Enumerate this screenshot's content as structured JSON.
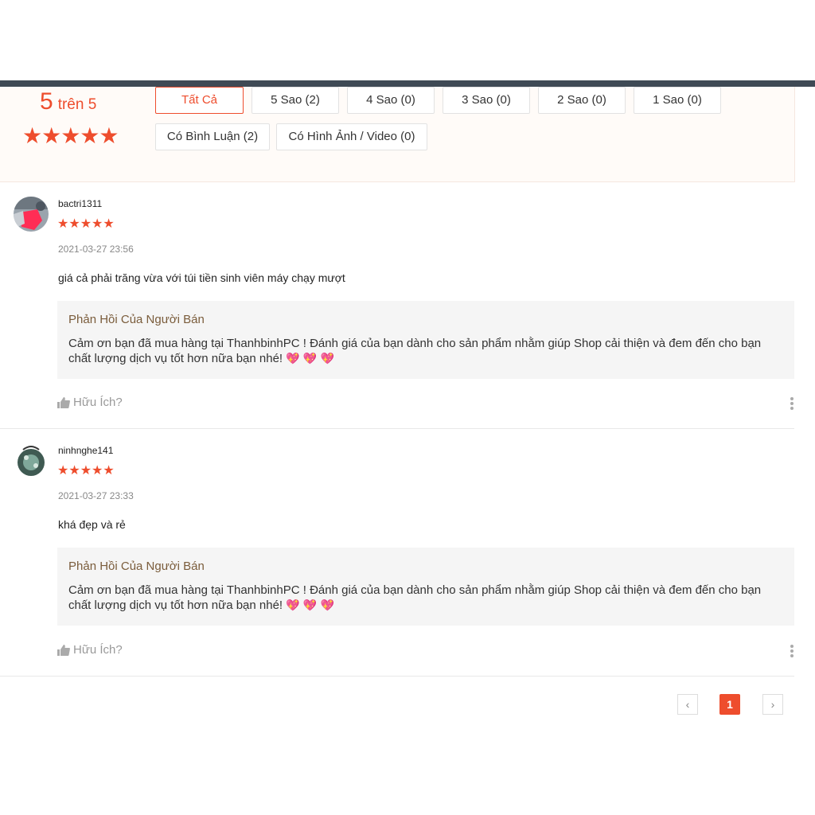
{
  "summary": {
    "score": "5",
    "score_suffix": "trên 5",
    "stars": "★★★★★"
  },
  "filters": [
    {
      "label": "Tất Cả"
    },
    {
      "label": "5 Sao (2)"
    },
    {
      "label": "4 Sao (0)"
    },
    {
      "label": "3 Sao (0)"
    },
    {
      "label": "2 Sao (0)"
    },
    {
      "label": "1 Sao (0)"
    },
    {
      "label": "Có Bình Luận (2)"
    },
    {
      "label": "Có Hình Ảnh / Video (0)"
    }
  ],
  "reviews": [
    {
      "username": "bactri1311",
      "stars": "★★★★★",
      "rating": 5,
      "time": "2021-03-27 23:56",
      "comment": "giá cả phải trăng vừa với túi tiền sinh viên máy chạy mượt",
      "reply_title": "Phản Hồi Của Người Bán",
      "reply_text": "Cảm ơn bạn đã mua hàng tại ThanhbinhPC ! Đánh giá của bạn dành cho sản phẩm nhằm giúp Shop cải thiện và đem đến cho bạn chất lượng dịch vụ tốt hơn nữa bạn nhé!",
      "helpful": "Hữu Ích?"
    },
    {
      "username": "ninhnghe141",
      "stars": "★★★★★",
      "rating": 5,
      "time": "2021-03-27 23:33",
      "comment": "khá đẹp và rẻ",
      "reply_title": "Phản Hồi Của Người Bán",
      "reply_text": "Cảm ơn bạn đã mua hàng tại ThanhbinhPC ! Đánh giá của bạn dành cho sản phẩm nhằm giúp Shop cải thiện và đem đến cho bạn chất lượng dịch vụ tốt hơn nữa bạn nhé!",
      "helpful": "Hữu Ích?"
    }
  ],
  "pagination": {
    "prev": "‹",
    "current": "1",
    "next": "›"
  },
  "colors": {
    "accent": "#ee4d2d",
    "reply_bg": "#f5f5f5",
    "summary_bg": "#fffbf8"
  }
}
